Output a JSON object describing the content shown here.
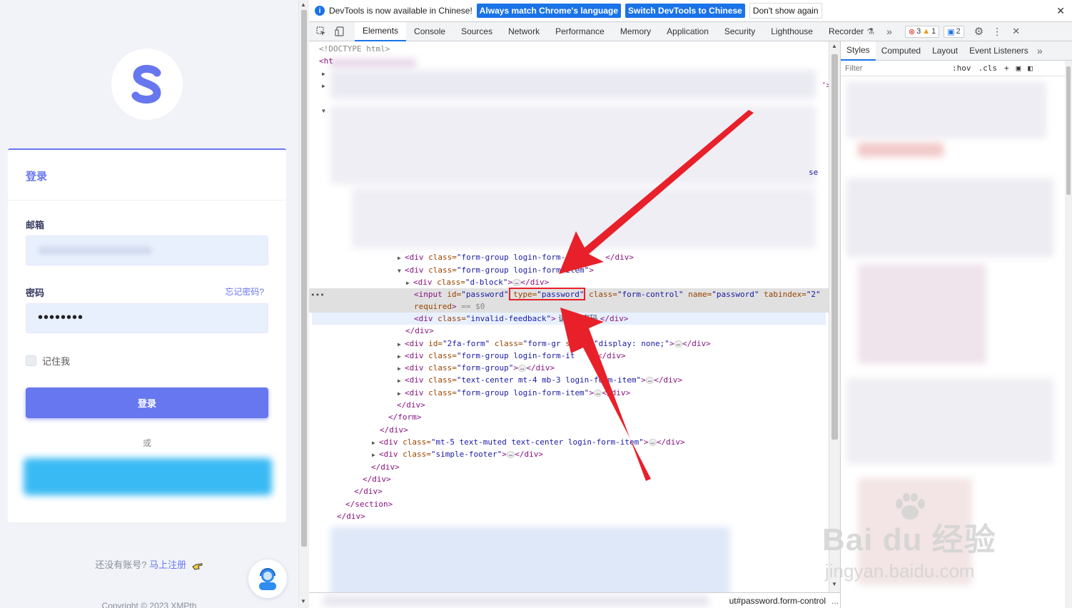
{
  "login": {
    "card_title": "登录",
    "email_label": "邮箱",
    "password_label": "密码",
    "forgot_password": "忘记密码?",
    "password_value": "••••••••",
    "remember_me": "记住我",
    "login_button": "登录",
    "or_text": "或",
    "no_account": "还没有账号?",
    "register_link": "马上注册",
    "copyright": "Copyright © 2023 XMPth",
    "brand_color": "#6777ef"
  },
  "devtools": {
    "infobar": {
      "message": "DevTools is now available in Chinese!",
      "btn_match": "Always match Chrome's language",
      "btn_switch": "Switch DevTools to Chinese",
      "btn_dismiss": "Don't show again"
    },
    "tabs": [
      "Elements",
      "Console",
      "Sources",
      "Network",
      "Performance",
      "Memory",
      "Application",
      "Security",
      "Lighthouse",
      "Recorder"
    ],
    "active_tab": "Elements",
    "errors_count": "3",
    "warnings_count": "1",
    "messages_count": "2",
    "styles_tabs": [
      "Styles",
      "Computed",
      "Layout",
      "Event Listeners"
    ],
    "filter_placeholder": "Filter",
    "hov_label": ":hov",
    "cls_label": ".cls",
    "breadcrumb": "ut#password.form-control",
    "breadcrumb_more": "..."
  },
  "dom": {
    "doctype": "<!DOCTYPE html>",
    "html_open": "<ht",
    "partial_tail_1": "'>",
    "partial_tail_2": "se",
    "fg1": {
      "tag": "<div ",
      "attr": "class=",
      "val": "\"form-group login-form-",
      "close": "</div>"
    },
    "fg2": {
      "tag": "<div ",
      "attr": "class=",
      "val": "\"form-group login-form-item\"",
      "end": ">"
    },
    "dblock": {
      "tag": "<div ",
      "attr": "class=",
      "val": "\"d-block\"",
      "end": ">",
      "close": "</div>"
    },
    "input_line": {
      "tag": "<input ",
      "id_attr": "id=",
      "id_val": "\"password\"",
      "type_attr": "type=",
      "type_val": "\"password\"",
      "class_attr": "class=",
      "class_val": "\"form-control\"",
      "name_attr": "name=",
      "name_val": "\"password\"",
      "tab_attr": "tabindex=",
      "tab_val": "\"2\""
    },
    "input_line2": {
      "required": "required",
      "end": ">",
      "eq": " == $0"
    },
    "feedback": {
      "tag": "<div ",
      "attr": "class=",
      "val": "\"invalid-feedback\"",
      "end": ">",
      "text": " 请填写密码 ",
      "close": "</div>"
    },
    "close_div": "</div>",
    "twofa": {
      "tag": "<div ",
      "id_attr": "id=",
      "id_val": "\"2fa-form\"",
      "class_attr": "class=",
      "class_val": "\"form-gr",
      "style_attr": "style=",
      "style_val": "\"display: none;\"",
      "end": ">",
      "close": "</div>"
    },
    "fg3": {
      "tag": "<div ",
      "attr": "class=",
      "val": "\"form-group login-form-it",
      "close": "</div>"
    },
    "fg4": {
      "tag": "<div ",
      "attr": "class=",
      "val": "\"form-group\"",
      "end": ">",
      "close": "</div>"
    },
    "tc": {
      "tag": "<div ",
      "attr": "class=",
      "val": "\"text-center mt-4 mb-3 login-form-item\"",
      "end": ">",
      "close": "</div>"
    },
    "fg5": {
      "tag": "<div ",
      "attr": "class=",
      "val": "\"form-group login-form-item\"",
      "end": ">",
      "close": "</div>"
    },
    "close_form": "</form>",
    "mt5": {
      "tag": "<div ",
      "attr": "class=",
      "val": "\"mt-5 text-muted text-center login-form-item\"",
      "end": ">",
      "close": "</div>"
    },
    "sf": {
      "tag": "<div ",
      "attr": "class=",
      "val": "\"simple-footer\"",
      "end": ">",
      "close": "</div>"
    },
    "close_section": "</section>"
  },
  "watermark": {
    "main": "Bai du 经验",
    "url": "jingyan.baidu.com"
  },
  "colors": {
    "devtools_accent": "#1a73e8",
    "annotation_red": "#e8202a",
    "tag": "#881280",
    "attr": "#994500",
    "value": "#1a1aa6"
  }
}
